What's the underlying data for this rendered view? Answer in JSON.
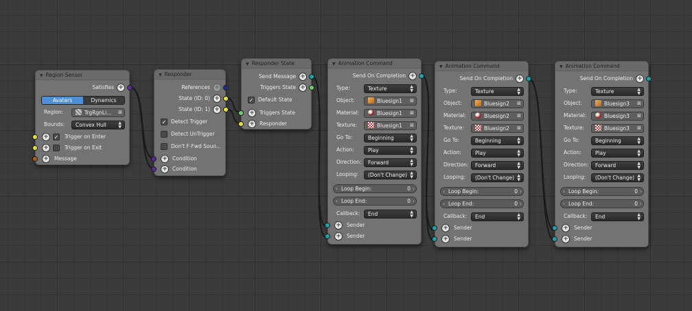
{
  "region_sensor": {
    "title": "Region Sensor",
    "satisfies": "Satisfies",
    "tabs": [
      "Avatars",
      "Dynamics"
    ],
    "region_label": "Region:",
    "region_value": "TrgRgnLi...",
    "bounds_label": "Bounds:",
    "bounds_value": "Convex Hull",
    "trigger_enter": "Trigger on Enter",
    "trigger_exit": "Trigger on Exit",
    "message": "Message"
  },
  "responder": {
    "title": "Responder",
    "references": "References",
    "state0": "State (ID: 0)",
    "state1": "State (ID: 1)",
    "detect_trigger": "Detect Trigger",
    "detect_untrigger": "Detect UnTrigger",
    "dont_ffwd": "Don't F-Fwd Soun...",
    "condition": "Condition"
  },
  "responder_state": {
    "title": "Responder State",
    "send_message": "Send Message",
    "triggers_state_out": "Triggers State",
    "default_state": "Default State",
    "triggers_state_in": "Triggers State",
    "responder": "Responder"
  },
  "anim_labels": {
    "send_on_completion": "Send On Completion",
    "type": "Type:",
    "object": "Object:",
    "material": "Material:",
    "texture": "Texture:",
    "goto": "Go To:",
    "action": "Action:",
    "direction": "Direction:",
    "looping": "Looping:",
    "loop_begin": "Loop Begin:",
    "loop_end": "Loop End:",
    "callback": "Callback:",
    "sender": "Sender"
  },
  "anim_nodes": [
    {
      "title": "Animation Command",
      "type": "Texture",
      "object": "Bluesign1",
      "material": "Bluesign1",
      "texture": "Bluesign1",
      "goto": "Beginning",
      "action": "Play",
      "direction": "Forward",
      "looping": "(Don't Change)",
      "loop_begin": "0",
      "loop_end": "0",
      "callback": "End"
    },
    {
      "title": "Animation Command",
      "type": "Texture",
      "object": "Bluesign2",
      "material": "Bluesign2",
      "texture": "Bluesign2",
      "goto": "Beginning",
      "action": "Play",
      "direction": "Forward",
      "looping": "(Don't Change)",
      "loop_begin": "0",
      "loop_end": "0",
      "callback": "End"
    },
    {
      "title": "Animation Command",
      "type": "Texture",
      "object": "Bluesign3",
      "material": "Bluesign3",
      "texture": "Bluesign3",
      "goto": "Beginning",
      "action": "Play",
      "direction": "Forward",
      "looping": "(Don't Change)",
      "loop_begin": "0",
      "loop_end": "0",
      "callback": "End"
    }
  ],
  "colors": {
    "wire": "#1a1a1a",
    "node_bg": "#737373",
    "tab_active": "#4d8ed6",
    "socket_yellow": "#e8e030",
    "socket_teal": "#1aa3a8",
    "socket_green": "#6ed36e"
  }
}
